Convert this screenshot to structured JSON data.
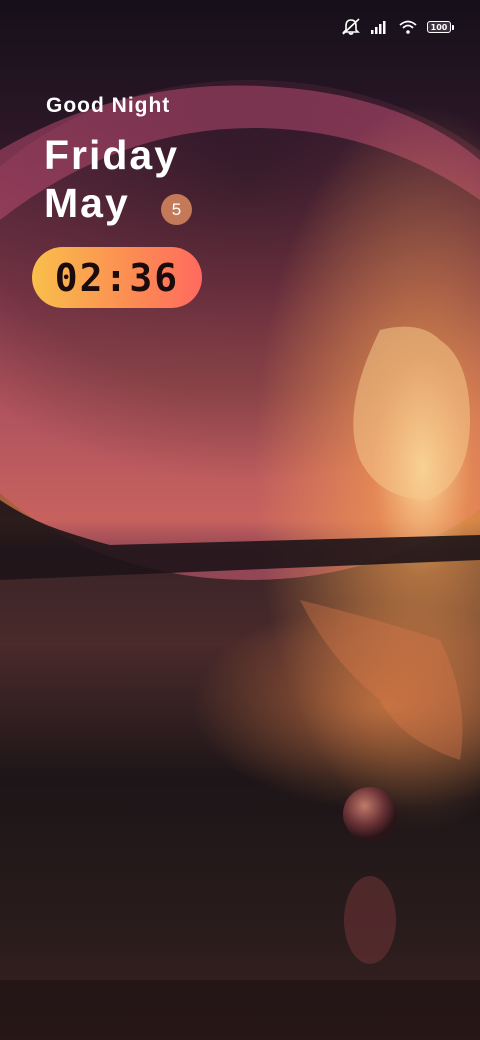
{
  "status_bar": {
    "icons": [
      "mute-icon",
      "signal-icon",
      "wifi-icon",
      "battery-icon"
    ],
    "battery_label": "100"
  },
  "lock_screen": {
    "greeting": "Good Night",
    "day": "Friday",
    "month": "May",
    "date": "5",
    "time": "02:36"
  },
  "colors": {
    "clock_gradient_start": "#f9bf4b",
    "clock_gradient_end": "#ff6a5f",
    "date_badge": "#c47a59",
    "text": "#ffffff"
  },
  "wallpaper": {
    "description_icon": "sunset-lake-planet-wallpaper"
  }
}
